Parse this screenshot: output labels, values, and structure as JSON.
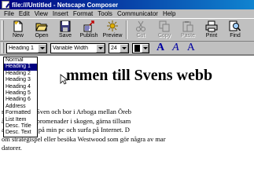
{
  "window": {
    "title": "file:///Untitled - Netscape Composer"
  },
  "menubar": {
    "items": [
      {
        "label": "File"
      },
      {
        "label": "Edit"
      },
      {
        "label": "View"
      },
      {
        "label": "Insert"
      },
      {
        "label": "Format"
      },
      {
        "label": "Tools"
      },
      {
        "label": "Communicator"
      },
      {
        "label": "Help"
      }
    ]
  },
  "toolbar": {
    "buttons": [
      {
        "label": "New",
        "icon": "new-document-icon",
        "enabled": true
      },
      {
        "label": "Open",
        "icon": "open-folder-icon",
        "enabled": true
      },
      {
        "label": "Save",
        "icon": "save-disk-icon",
        "enabled": true
      },
      {
        "label": "Publish",
        "icon": "publish-icon",
        "enabled": true
      },
      {
        "label": "Preview",
        "icon": "preview-icon",
        "enabled": true
      },
      {
        "label": "Cut",
        "icon": "cut-icon",
        "enabled": false
      },
      {
        "label": "Copy",
        "icon": "copy-icon",
        "enabled": false
      },
      {
        "label": "Paste",
        "icon": "paste-icon",
        "enabled": false
      },
      {
        "label": "Print",
        "icon": "print-icon",
        "enabled": true
      },
      {
        "label": "Find",
        "icon": "find-icon",
        "enabled": true
      }
    ]
  },
  "format": {
    "paragraph_style": "Heading 1",
    "font": "Variable Width",
    "size": "24",
    "color": "#000000",
    "bold_label": "A",
    "italic_label": "A",
    "third_label": "A"
  },
  "dropdown": {
    "options": [
      "Normal",
      "Heading 1",
      "Heading 2",
      "Heading 3",
      "Heading 4",
      "Heading 5",
      "Heading 6",
      "Address",
      "Formatted",
      "List Item",
      "Desc. Title",
      "Desc. Text"
    ],
    "selected_index": 1
  },
  "document": {
    "heading": "mmen till Svens webb",
    "lines": [
      "re! Jag heter Sven och bor i Arboga mellan Öreb",
      "år ofta långa promenader i skogen, gärna tillsam",
      "a strategispel på min pc och surfa på Internet. D",
      "om strategispel eller besöka Westwood som gör några av mar",
      "datorer."
    ]
  },
  "colors": {
    "titlebar_start": "#000080",
    "titlebar_end": "#1084d0",
    "chrome": "#c0c0c0",
    "selection": "#000080",
    "format_accent": "#0000a0"
  }
}
